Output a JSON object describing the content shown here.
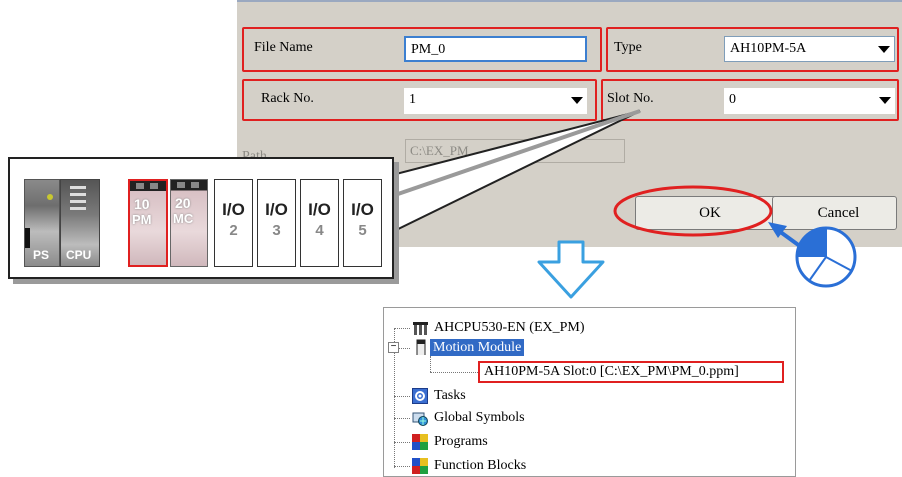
{
  "dialog": {
    "file_name_label": "File Name",
    "file_name_value": "PM_0",
    "type_label": "Type",
    "type_value": "AH10PM-5A",
    "rack_label": "Rack No.",
    "rack_value": "1",
    "slot_label": "Slot No.",
    "slot_value": "0",
    "path_label": "Path",
    "path_value": "C:\\EX_PM",
    "ok_label": "OK",
    "cancel_label": "Cancel"
  },
  "rack": {
    "power_label": "PS",
    "cpu_label": "CPU",
    "pm_number": "10",
    "pm_label": "PM",
    "mc_number": "20",
    "mc_label": "MC",
    "io_slots": [
      {
        "label": "I/O",
        "number": "2"
      },
      {
        "label": "I/O",
        "number": "3"
      },
      {
        "label": "I/O",
        "number": "4"
      },
      {
        "label": "I/O",
        "number": "5"
      }
    ]
  },
  "tree": {
    "root": "AHCPU530-EN  (EX_PM)",
    "motion_module": "Motion Module",
    "motion_child": "AH10PM-5A Slot:0 [C:\\EX_PM\\PM_0.ppm]",
    "tasks": "Tasks",
    "global_symbols": "Global Symbols",
    "programs": "Programs",
    "function_blocks": "Function Blocks",
    "expand_symbol": "−"
  },
  "colors": {
    "highlight_red": "#e02020",
    "arrow_blue": "#2a6fd6",
    "dialog_bg": "#d4d0c8",
    "selection_blue": "#316ac5"
  }
}
